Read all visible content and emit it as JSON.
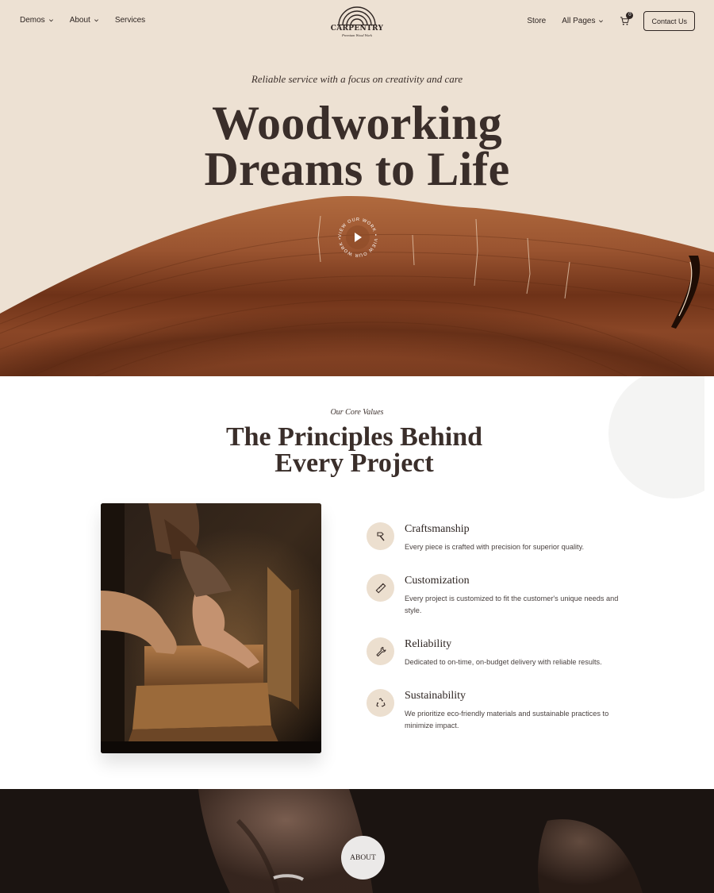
{
  "nav": {
    "left_items": [
      {
        "label": "Demos",
        "has_dropdown": true
      },
      {
        "label": "About",
        "has_dropdown": true
      },
      {
        "label": "Services",
        "has_dropdown": false
      }
    ],
    "right_items": [
      {
        "label": "Store",
        "has_dropdown": false
      },
      {
        "label": "All Pages",
        "has_dropdown": true
      }
    ],
    "cart_count": "0",
    "contact_label": "Contact Us"
  },
  "logo": {
    "name": "CARPENTRY",
    "tagline": "Premium Wood Work"
  },
  "hero": {
    "tagline": "Reliable service with a focus on creativity and care",
    "title_line1": "Woodworking",
    "title_line2": "Dreams to Life",
    "play_ring_text": "VIEW OUR WORK • VIEW OUR WORK • "
  },
  "values": {
    "eyebrow": "Our Core Values",
    "title_line1": "The Principles Behind",
    "title_line2": "Every Project",
    "items": [
      {
        "icon": "hammer-icon",
        "title": "Craftsmanship",
        "desc": "Every piece is crafted with precision for superior quality."
      },
      {
        "icon": "ruler-icon",
        "title": "Customization",
        "desc": "Every project is customized to fit the customer's unique needs and style."
      },
      {
        "icon": "wrench-icon",
        "title": "Reliability",
        "desc": "Dedicated to on-time, on-budget delivery with reliable results."
      },
      {
        "icon": "recycle-icon",
        "title": "Sustainability",
        "desc": "We prioritize eco-friendly materials and sustainable practices to minimize impact."
      }
    ]
  },
  "about": {
    "button_label": "ABOUT"
  },
  "colors": {
    "hero_bg": "#ede1d3",
    "text_dark": "#3a2e2a",
    "icon_bg": "#ecdfcf",
    "wood": "#8a4626",
    "about_bg": "#1b1411"
  }
}
